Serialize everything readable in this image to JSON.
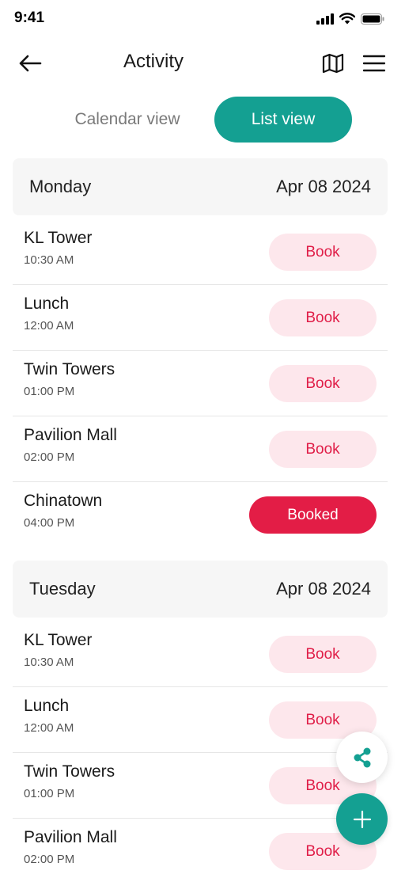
{
  "status_bar": {
    "time": "9:41",
    "icons": [
      "signal-icon",
      "wifi-icon",
      "battery-icon"
    ]
  },
  "header": {
    "title": "Activity",
    "icons": [
      "back-arrow-icon",
      "map-icon",
      "hamburger-menu-icon"
    ]
  },
  "view_toggle": {
    "calendar_label": "Calendar view",
    "list_label": "List view",
    "selected": "List view"
  },
  "days": [
    {
      "name": "Monday",
      "date": "Apr 08 2024",
      "items": [
        {
          "title": "KL Tower",
          "time": "10:30 AM",
          "button": "Book"
        },
        {
          "title": "Lunch",
          "time": "12:00 AM",
          "button": "Book"
        },
        {
          "title": "Twin Towers",
          "time": "01:00 PM",
          "button": "Book"
        },
        {
          "title": "Pavilion Mall",
          "time": "02:00 PM",
          "button": "Book"
        },
        {
          "title": "Chinatown",
          "time": "04:00 PM",
          "button": "Booked"
        }
      ]
    },
    {
      "name": "Tuesday",
      "date": "Apr 08 2024",
      "items": [
        {
          "title": "KL Tower",
          "time": "10:30 AM",
          "button": "Book"
        },
        {
          "title": "Lunch",
          "time": "12:00 AM",
          "button": "Book"
        },
        {
          "title": "Twin Towers",
          "time": "01:00 PM",
          "button": "Book"
        },
        {
          "title": "Pavilion Mall",
          "time": "02:00 PM",
          "button": "Book"
        }
      ]
    }
  ],
  "fabs": [
    "share-icon",
    "plus-icon"
  ],
  "colors": {
    "accent": "#14a092",
    "book_bg": "#fde7ec",
    "book_text": "#e01e48",
    "booked_bg": "#e31d46",
    "day_header_bg": "#f6f6f6"
  }
}
